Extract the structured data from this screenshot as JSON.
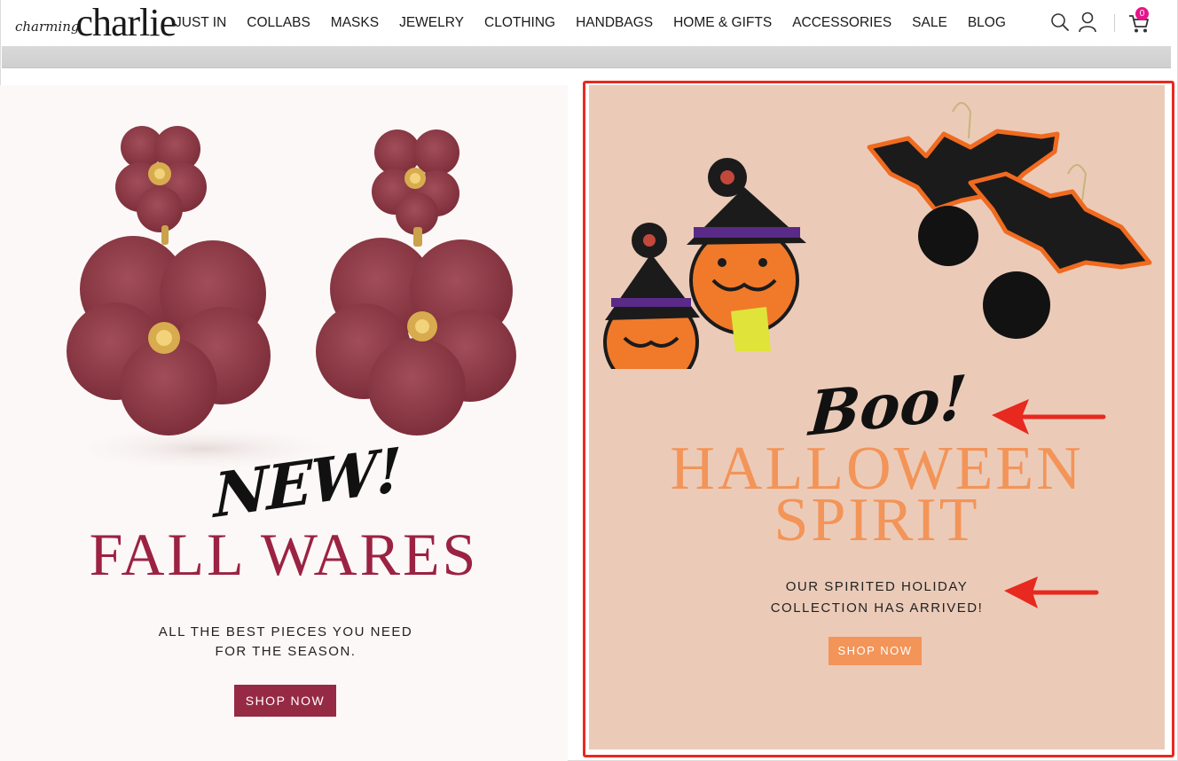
{
  "header": {
    "logo_small": "charming",
    "logo_big": "charlie",
    "nav": [
      "JUST IN",
      "COLLABS",
      "MASKS",
      "JEWELRY",
      "CLOTHING",
      "HANDBAGS",
      "HOME & GIFTS",
      "ACCESSORIES",
      "SALE",
      "BLOG"
    ],
    "cart_count": "0",
    "icons": [
      "search-icon",
      "account-icon",
      "cart-icon"
    ]
  },
  "promo_left": {
    "tagline": "NEW!",
    "title": "FALL WARES",
    "subtitle_line1": "ALL THE BEST PIECES YOU NEED",
    "subtitle_line2": "FOR THE SEASON.",
    "button": "SHOP NOW",
    "accent_color": "#962a45"
  },
  "promo_right": {
    "tagline": "Boo!",
    "title_line1": "HALLOWEEN",
    "title_line2": "SPIRIT",
    "subtitle_line1": "OUR SPIRITED HOLIDAY",
    "subtitle_line2": "COLLECTION HAS ARRIVED!",
    "button": "SHOP NOW",
    "accent_color": "#f39458",
    "highlight_color": "#e8291f"
  }
}
